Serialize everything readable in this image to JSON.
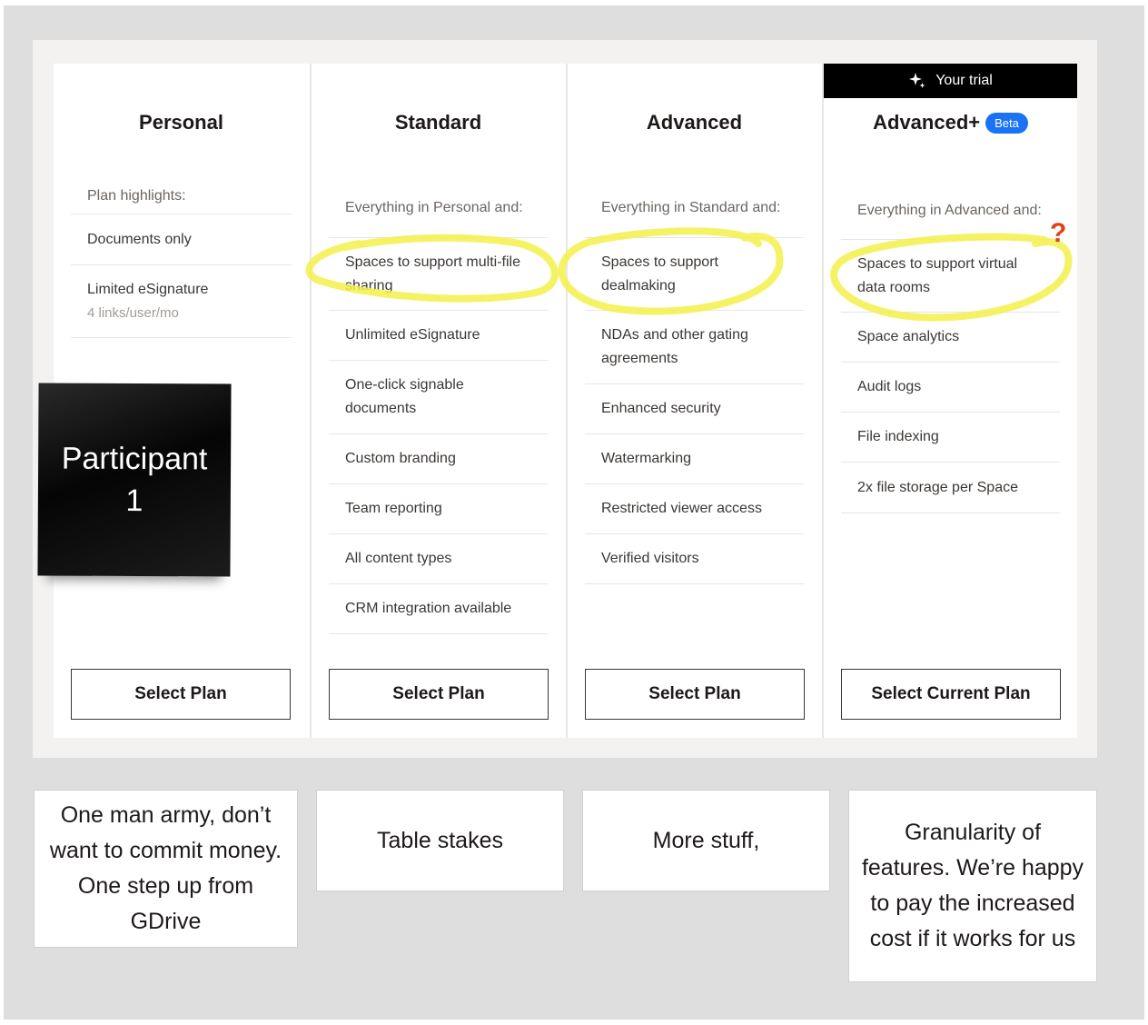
{
  "plans": [
    {
      "name": "Personal",
      "features": [
        {
          "text": "Plan highlights:",
          "head": true
        },
        {
          "text": "Documents only"
        },
        {
          "text": "Limited eSignature",
          "sub": "4 links/user/mo"
        }
      ],
      "button": "Select Plan"
    },
    {
      "name": "Standard",
      "features": [
        {
          "text": "Everything in Personal and:",
          "head": true
        },
        {
          "text": "Spaces to support multi-file sharing"
        },
        {
          "text": "Unlimited eSignature"
        },
        {
          "text": "One-click signable documents"
        },
        {
          "text": "Custom branding"
        },
        {
          "text": "Team reporting"
        },
        {
          "text": "All content types"
        },
        {
          "text": "CRM integration available"
        }
      ],
      "button": "Select Plan"
    },
    {
      "name": "Advanced",
      "features": [
        {
          "text": "Everything in Standard and:",
          "head": true
        },
        {
          "text": "Spaces to support dealmaking"
        },
        {
          "text": "NDAs and other gating agreements"
        },
        {
          "text": "Enhanced security"
        },
        {
          "text": "Watermarking"
        },
        {
          "text": "Restricted viewer access"
        },
        {
          "text": "Verified visitors"
        }
      ],
      "button": "Select Plan"
    },
    {
      "name": "Advanced+",
      "badge": "Beta",
      "trial_banner": "Your trial",
      "features": [
        {
          "text": "Everything in Advanced and:",
          "head": true
        },
        {
          "text": "Spaces to support virtual data rooms"
        },
        {
          "text": "Space analytics"
        },
        {
          "text": "Audit logs"
        },
        {
          "text": "File indexing"
        },
        {
          "text": "2x file storage per Space"
        }
      ],
      "button": "Select Current Plan"
    }
  ],
  "sticky_note": "Participant 1",
  "notes": [
    "One man army, don’t want to commit money. One step up from GDrive",
    "Table stakes",
    "More stuff,",
    "Granularity of features. We’re happy to pay the increased cost if it works for us"
  ],
  "annotation_mark": "?",
  "colors": {
    "highlight": "#f5f04a",
    "question_mark": "#e2401c",
    "beta_badge": "#1a73f5",
    "trial_banner": "#000000"
  }
}
